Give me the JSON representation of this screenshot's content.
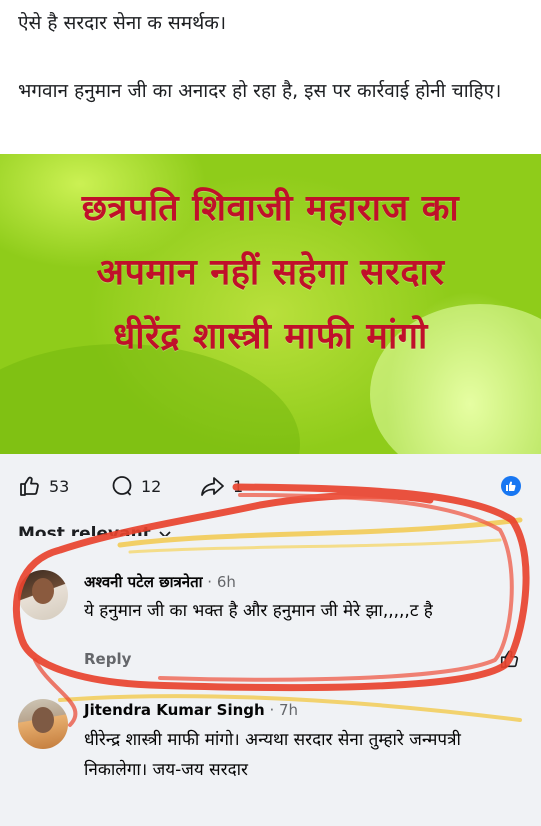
{
  "post": {
    "line1": "ऐसे है सरदार सेना क समर्थक।",
    "line2": "भगवान हनुमान जी का अनादर हो रहा है, इस पर कार्रवाई होनी चाहिए।"
  },
  "banner": {
    "lines": [
      "छत्रपति शिवाजी महाराज का",
      "अपमान नहीं सहेगा सरदार",
      "धीरेंद्र शास्त्री माफी मांगो"
    ]
  },
  "reactions": {
    "likes": "53",
    "comments": "12",
    "shares": "1"
  },
  "sort_label": "Most relevant",
  "comments": [
    {
      "author": "अश्वनी पटेल छात्रनेता",
      "time": " · 6h",
      "text": "ये हनुमान जी का भक्त है और हनुमान जी मेरे झा,,,,,ट है",
      "reply": "Reply"
    },
    {
      "author": "Jitendra Kumar Singh",
      "time": " · 7h",
      "text": "धीरेन्द्र शास्त्री माफी मांगो। अन्यथा सरदार सेना तुम्हारे जन्मपत्री निकालेगा। जय-जय सरदार"
    }
  ],
  "colors": {
    "banner_text": "#c0102a",
    "banner_green": "#8fcc1a",
    "annotation_red": "#e8432e",
    "annotation_yellow": "#f2c94c",
    "facebook_blue": "#1877f2"
  }
}
